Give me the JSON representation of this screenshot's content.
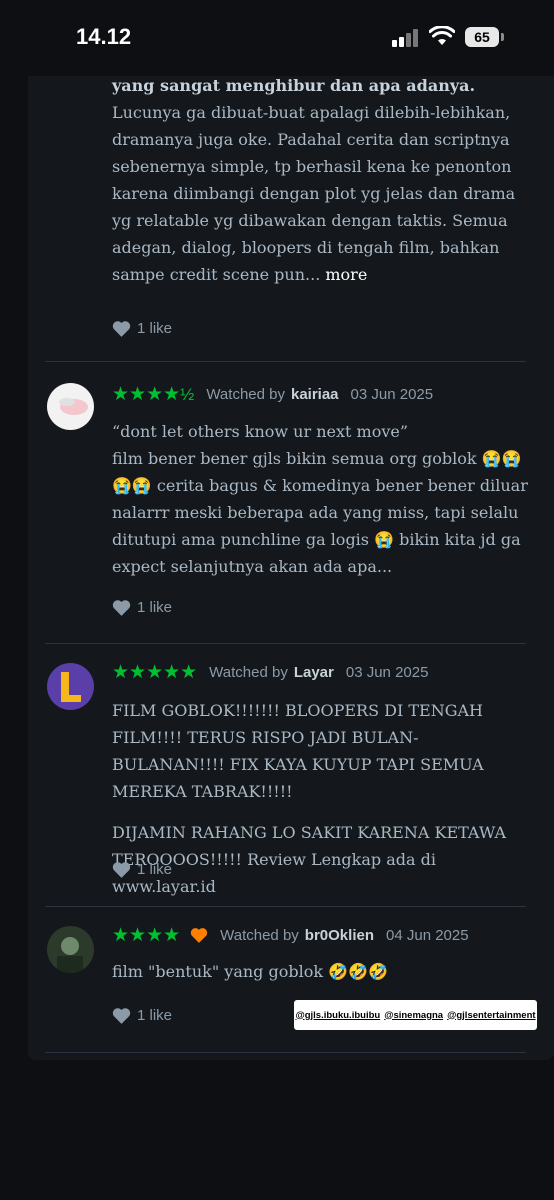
{
  "status_bar": {
    "time": "14.12",
    "battery": "65"
  },
  "reviews": [
    {
      "text_bold": "yang sangat menghibur dan apa adanya.",
      "text": "Lucunya ga dibuat-buat apalagi dilebih-lebihkan, dramanya juga oke. Padahal cerita dan scriptnya sebenernya simple, tp berhasil kena ke penonton karena diimbangi dengan plot yg jelas dan drama yg relatable yg dibawakan dengan taktis. Semua adegan, dialog, bloopers di tengah film, bahkan sampe credit scene pun...",
      "more_label": "more",
      "likes": "1 like"
    },
    {
      "rating": "★★★★",
      "rating_half": "½",
      "watched_label": "Watched by",
      "user": "kairiaa",
      "date": "03 Jun 2025",
      "text_lines": [
        "“dont let others know ur next move”",
        "film bener bener gjls bikin semua org goblok 😭😭😭😭 cerita bagus & komedinya bener bener diluar nalarrr meski beberapa ada yang miss, tapi selalu ditutupi ama punchline ga logis 😭 bikin kita jd ga expect selanjutnya akan ada apa..."
      ],
      "likes": "1 like"
    },
    {
      "rating": "★★★★★",
      "watched_label": "Watched by",
      "user": "Layar",
      "date": "03 Jun 2025",
      "paragraph_1": "FILM GOBLOK!!!!!!! BLOOPERS DI TENGAH FILM!!!! TERUS RISPO JADI BULAN-BULANAN!!!! FIX KAYA KUYUP TAPI SEMUA MEREKA TABRAK!!!!!",
      "paragraph_2": "DIJAMIN RAHANG LO SAKIT KARENA KETAWA TEROOOOS!!!!! Review Lengkap ada di www.layar.id",
      "likes": "1 like"
    },
    {
      "rating": "★★★★",
      "watched_label": "Watched by",
      "user": "br0Oklien",
      "date": "04 Jun 2025",
      "text": "film \"bentuk\" yang goblok 🤣🤣🤣",
      "likes": "1 like"
    }
  ],
  "tag_overlay": [
    "@gjls.ibuku.ibuibu",
    "@sinemagna",
    "@gjlsentertainment"
  ],
  "colors": {
    "star_green": "#00c030",
    "liked_orange": "#ff8000",
    "background": "#14181c"
  }
}
